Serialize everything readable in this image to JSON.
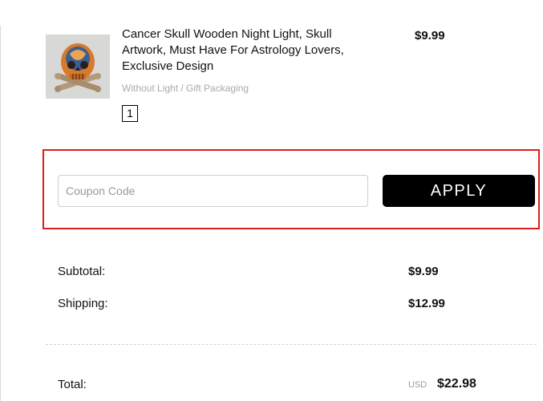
{
  "product": {
    "title": "Cancer Skull Wooden Night Light, Skull Artwork, Must Have For Astrology Lovers, Exclusive Design",
    "variant": "Without Light / Gift Packaging",
    "quantity": "1",
    "price": "$9.99",
    "thumbnail_icon": "skull-artwork-thumbnail"
  },
  "coupon": {
    "placeholder": "Coupon Code",
    "value": "",
    "apply_label": "APPLY",
    "highlight_color": "#e01b1b"
  },
  "summary": {
    "subtotal_label": "Subtotal:",
    "subtotal_value": "$9.99",
    "shipping_label": "Shipping:",
    "shipping_value": "$12.99",
    "total_label": "Total:",
    "currency": "USD",
    "total_value": "$22.98"
  }
}
